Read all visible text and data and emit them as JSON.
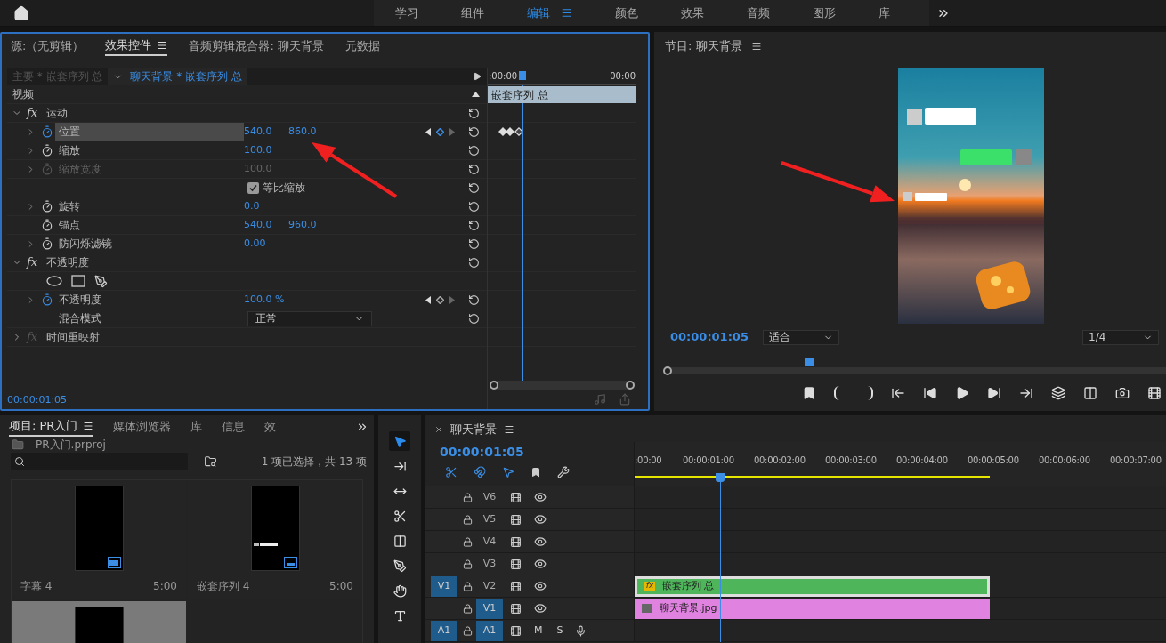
{
  "workspaces": [
    {
      "label": "学习",
      "selected": false
    },
    {
      "label": "组件",
      "selected": false
    },
    {
      "label": "编辑",
      "selected": true
    },
    {
      "label": "颜色",
      "selected": false
    },
    {
      "label": "效果",
      "selected": false
    },
    {
      "label": "音频",
      "selected": false
    },
    {
      "label": "图形",
      "selected": false
    },
    {
      "label": "库",
      "selected": false
    }
  ],
  "effect_controls": {
    "tabs": [
      {
        "label": "源:（无剪辑）",
        "selected": false
      },
      {
        "label": "效果控件",
        "selected": true
      },
      {
        "label": "音频剪辑混合器: 聊天背景",
        "selected": false
      },
      {
        "label": "元数据",
        "selected": false
      }
    ],
    "clip_tabs": [
      {
        "label": "主要 * 嵌套序列 总",
        "selected": false
      },
      {
        "label": "聊天背景 * 嵌套序列 总",
        "selected": true
      }
    ],
    "group": "视频",
    "rows": [
      {
        "kind": "section",
        "badge": "fx",
        "label": "运动",
        "expanded": true,
        "enabled": true
      },
      {
        "kind": "property",
        "label": "位置",
        "values": [
          "540.0",
          "860.0"
        ],
        "expandable": true,
        "animated": true,
        "disabled": false,
        "highlighted": true,
        "keyframe_nav": true,
        "has_keyframes": true
      },
      {
        "kind": "property",
        "label": "缩放",
        "values": [
          "100.0"
        ],
        "expandable": true,
        "animated": false,
        "disabled": false,
        "highlighted": false,
        "keyframe_nav": false,
        "has_keyframes": false
      },
      {
        "kind": "property",
        "label": "缩放宽度",
        "values": [
          "100.0"
        ],
        "expandable": true,
        "animated": false,
        "disabled": true,
        "highlighted": false,
        "keyframe_nav": false,
        "has_keyframes": false
      },
      {
        "kind": "checkbox",
        "label": "等比缩放",
        "checked": true
      },
      {
        "kind": "property",
        "label": "旋转",
        "values": [
          "0.0"
        ],
        "expandable": true,
        "animated": false,
        "disabled": false,
        "highlighted": false,
        "keyframe_nav": false,
        "has_keyframes": false
      },
      {
        "kind": "property",
        "label": "锚点",
        "values": [
          "540.0",
          "960.0"
        ],
        "expandable": false,
        "animated": false,
        "disabled": false,
        "highlighted": false,
        "keyframe_nav": false,
        "has_keyframes": false
      },
      {
        "kind": "property",
        "label": "防闪烁滤镜",
        "values": [
          "0.00"
        ],
        "expandable": true,
        "animated": false,
        "disabled": false,
        "highlighted": false,
        "keyframe_nav": false,
        "has_keyframes": false
      },
      {
        "kind": "section",
        "badge": "fx",
        "label": "不透明度",
        "expanded": true,
        "enabled": true
      },
      {
        "kind": "masks"
      },
      {
        "kind": "property",
        "label": "不透明度",
        "values": [
          "100.0 %"
        ],
        "expandable": true,
        "animated": true,
        "disabled": false,
        "highlighted": false,
        "keyframe_nav": true,
        "has_keyframes": false
      },
      {
        "kind": "dropdown",
        "label": "混合模式",
        "value": "正常"
      },
      {
        "kind": "section",
        "badge": "fx",
        "label": "时间重映射",
        "expanded": false,
        "enabled": false
      }
    ],
    "mini_timeline": {
      "start": ":00:00",
      "end": "00:00",
      "clip": "嵌套序列 总",
      "playhead": {
        "level": 0.235
      }
    },
    "timecode": "00:00:01:05"
  },
  "program": {
    "title": "节目: 聊天背景",
    "timecode": "00:00:01:05",
    "zoom": "适合",
    "resolution": "1/4",
    "playhead": {
      "level": 0.288
    }
  },
  "project": {
    "tabs": [
      {
        "label": "项目: PR入门",
        "selected": true
      },
      {
        "label": "媒体浏览器",
        "selected": false
      },
      {
        "label": "库",
        "selected": false
      },
      {
        "label": "信息",
        "selected": false
      },
      {
        "label": "效",
        "selected": false
      }
    ],
    "file": "PR入门.prproj",
    "selection_info": "1 项已选择，共 13 项",
    "items": [
      {
        "kind": "caption",
        "name": "字幕 4",
        "duration": "5:00",
        "selected": false
      },
      {
        "kind": "sequence",
        "name": "嵌套序列 4",
        "duration": "5:00",
        "selected": false
      },
      {
        "kind": "blank",
        "selected": true
      }
    ]
  },
  "tools": [
    {
      "kind": "selection",
      "selected": true
    },
    {
      "kind": "track-select",
      "selected": false
    },
    {
      "kind": "ripple",
      "selected": false
    },
    {
      "kind": "razor",
      "selected": false
    },
    {
      "kind": "slip",
      "selected": false
    },
    {
      "kind": "pen",
      "selected": false
    },
    {
      "kind": "hand",
      "selected": false
    },
    {
      "kind": "type",
      "selected": false
    }
  ],
  "timeline": {
    "title": "聊天背景",
    "timecode": "00:00:01:05",
    "ruler": [
      ":00:00",
      "00:00:01:00",
      "00:00:02:00",
      "00:00:03:00",
      "00:00:04:00",
      "00:00:05:00",
      "00:00:06:00",
      "00:00:07:00"
    ],
    "playhead": {
      "level": 0.161
    },
    "tracks": [
      {
        "kind": "video",
        "label": "V6",
        "targeted": false
      },
      {
        "kind": "video",
        "label": "V5",
        "targeted": false
      },
      {
        "kind": "video",
        "label": "V4",
        "targeted": false
      },
      {
        "kind": "video",
        "label": "V3",
        "targeted": false
      },
      {
        "kind": "video",
        "label": "V2",
        "source": "V1",
        "targeted": false,
        "clip": {
          "label": "嵌套序列 总",
          "badge": "fx",
          "color": "#4fb55a",
          "selected": true
        }
      },
      {
        "kind": "video",
        "label": "V1",
        "targeted": true,
        "clip": {
          "label": "聊天背景.jpg",
          "color": "#e082e0",
          "selected": false
        }
      },
      {
        "kind": "audio",
        "label": "A1",
        "source": "A1",
        "targeted": true,
        "mute": "M",
        "solo": "S"
      }
    ]
  }
}
